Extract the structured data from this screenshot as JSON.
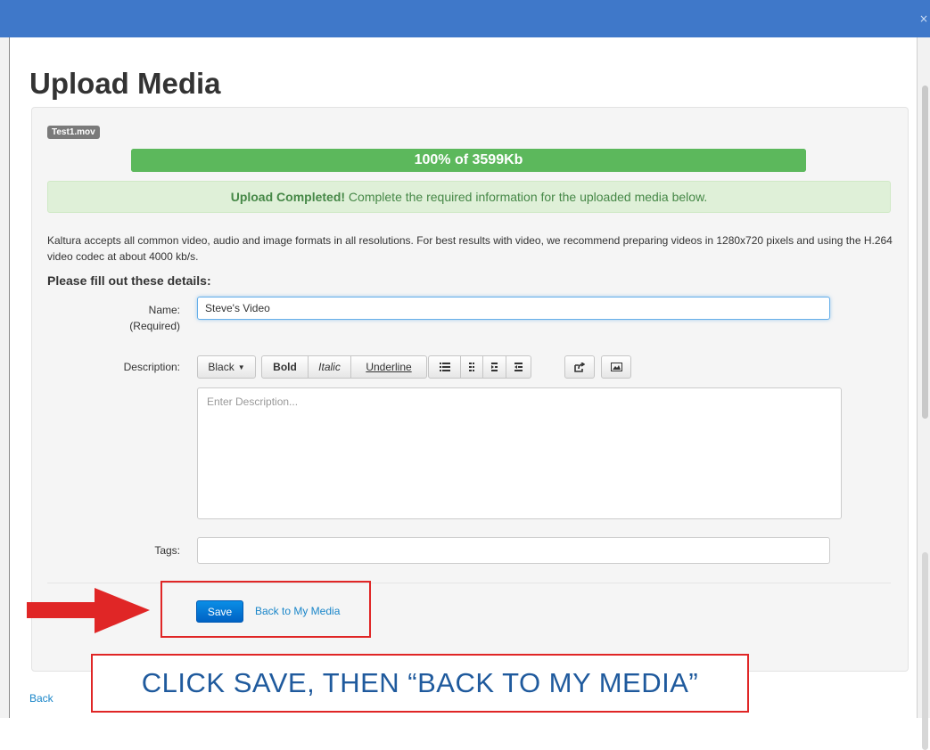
{
  "window": {
    "close_glyph": "×"
  },
  "page": {
    "title": "Upload Media"
  },
  "upload": {
    "file_name": "Test1.mov",
    "progress_percent": 100,
    "progress_text": "100% of 3599Kb"
  },
  "alert": {
    "strong": "Upload Completed!",
    "message": " Complete the required information for the uploaded media below."
  },
  "info": {
    "text": "Kaltura accepts all common video, audio and image formats in all resolutions.  For best results with video, we recommend preparing videos in 1280x720 pixels and using the H.264 video codec at about 4000 kb/s."
  },
  "form": {
    "section_title": "Please fill out these details:",
    "name_label": "Name:",
    "required_label": "(Required)",
    "name_value": "Steve's Video",
    "description_label": "Description:",
    "description_placeholder": "Enter Description...",
    "tags_label": "Tags:",
    "tags_value": ""
  },
  "editor_toolbar": {
    "color_label": "Black",
    "bold_label": "Bold",
    "italic_label": "Italic",
    "underline_label": "Underline",
    "icons": [
      "unordered-list-icon",
      "ordered-list-icon",
      "outdent-icon",
      "indent-icon",
      "link-icon",
      "image-icon"
    ]
  },
  "actions": {
    "save_label": "Save",
    "back_to_media_label": "Back to My Media",
    "back_label": "Back"
  },
  "annotation": {
    "instruction": "CLICK SAVE, THEN “BACK TO MY MEDIA”",
    "color": "#e02626",
    "text_color": "#1f5a9d"
  },
  "colors": {
    "titlebar": "#3f78c9",
    "progress": "#5cb85c",
    "alert_bg": "#dff0d8",
    "alert_text": "#468847",
    "primary_button": "#0062c4",
    "link": "#1a86c9"
  }
}
